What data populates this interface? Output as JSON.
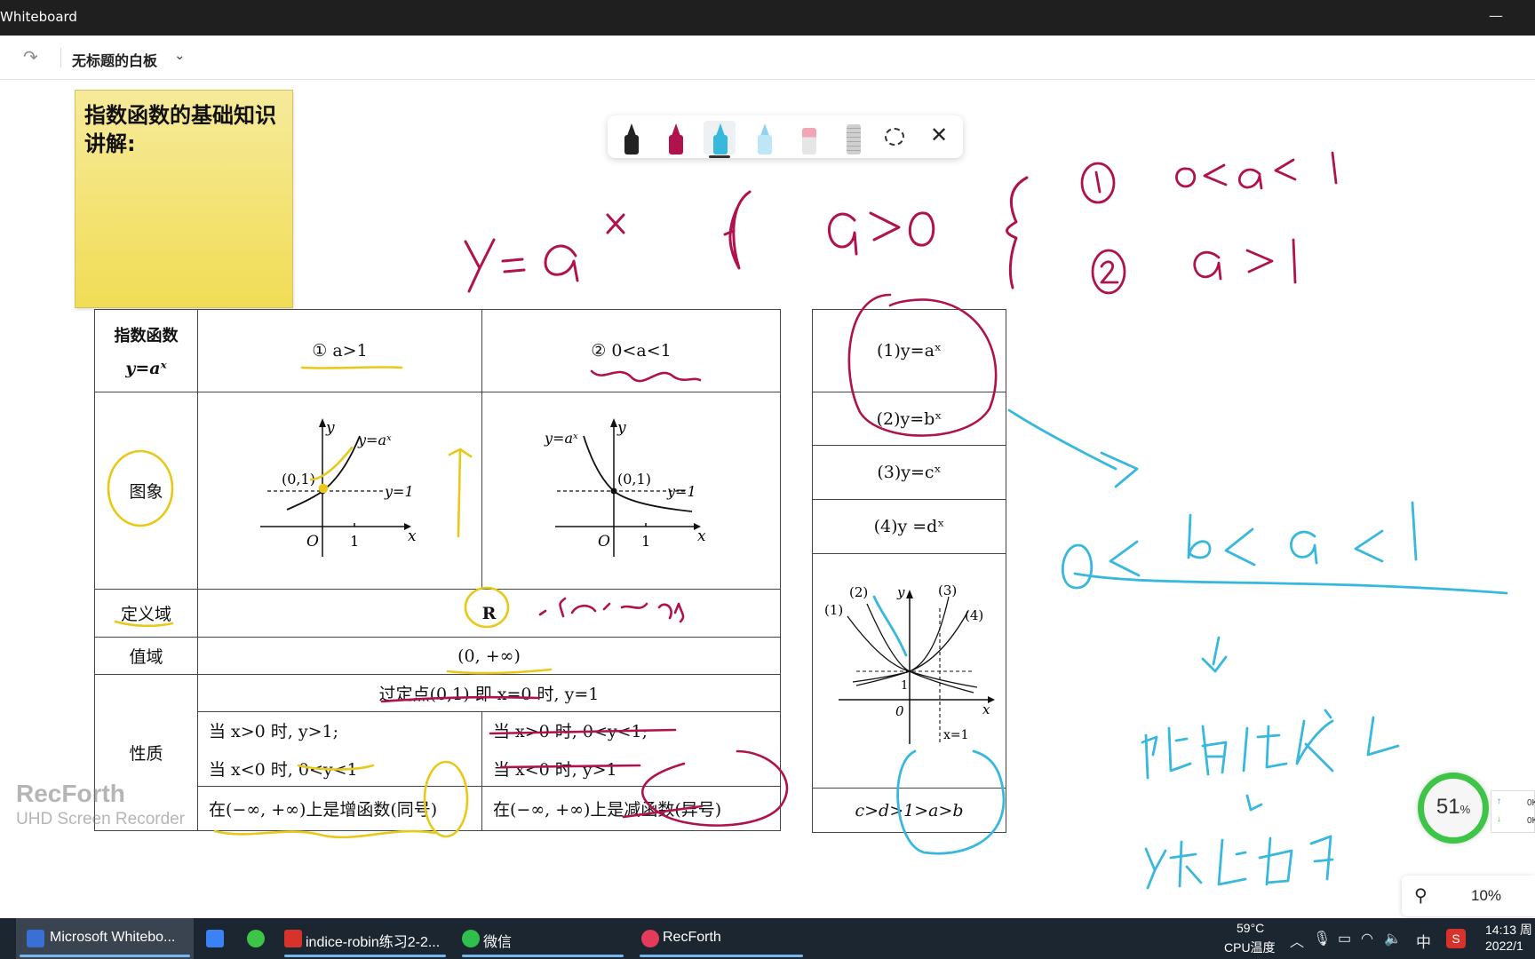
{
  "window": {
    "app_title": "Whiteboard"
  },
  "header": {
    "board_title": "无标题的白板"
  },
  "sticky_note": {
    "text": "指数函数的基础知识讲解:"
  },
  "pen_toolbar": {
    "tools": [
      {
        "name": "black-pen",
        "color": "#222222"
      },
      {
        "name": "magenta-pen",
        "color": "#b0124e"
      },
      {
        "name": "cyan-pen",
        "color": "#37b8dc"
      },
      {
        "name": "highlighter",
        "color": "#8fd4f2"
      },
      {
        "name": "eraser",
        "color": "#f2a5b5"
      },
      {
        "name": "ruler",
        "color": "#cfcfcf"
      }
    ],
    "selected_index": 2
  },
  "table": {
    "header_left_1": "指数函数",
    "header_left_2": "y=aˣ",
    "case1": "① a>1",
    "case2": "② 0<a<1",
    "row_graph": "图象",
    "row_domain": "定义域",
    "domain_value": "R",
    "row_range": "值域",
    "range_value": "(0, +∞)",
    "row_props": "性质",
    "fixed_point": "过定点(0,1)  即 x=0 时, y=1",
    "case1_p1": "当 x>0 时, y>1;",
    "case1_p2": "当 x<0 时, 0<y<1",
    "case2_p1": "当 x>0 时, 0<y<1;",
    "case2_p2": "当 x<0 时, y>1",
    "case1_mono": "在(−∞, +∞)上是增函数(同号)",
    "case2_mono": "在(−∞, +∞)上是减函数(异号)",
    "graph1": {
      "y_label": "y",
      "x_label": "x",
      "origin": "O",
      "one": "1",
      "point": "(0,1)",
      "curve": "y=aˣ",
      "asym": "y=1"
    },
    "graph2": {
      "y_label": "y",
      "x_label": "x",
      "origin": "O",
      "one": "1",
      "point": "(0,1)",
      "curve": "y=aˣ",
      "asym": "y=1"
    }
  },
  "side_table": {
    "rows": [
      "(1)y=aˣ",
      "(2)y=bˣ",
      "(3)y=cˣ",
      "(4)y =dˣ"
    ],
    "graph": {
      "l1": "(1)",
      "l2": "(2)",
      "l3": "(3)",
      "l4": "(4)",
      "y": "y",
      "x": "x",
      "zero": "0",
      "one": "1",
      "xeq1": "x=1"
    },
    "result": "c>d>1>a>b"
  },
  "watermark": {
    "title": "RecForth",
    "subtitle": "UHD Screen Recorder"
  },
  "zoom": {
    "level": "10%"
  },
  "cpu_widget": {
    "value": "51",
    "unit": "%",
    "net_up": "0K",
    "net_down": "0K"
  },
  "taskbar": {
    "items": [
      {
        "label": "Microsoft Whitebo...",
        "active": true
      },
      {
        "label": "indice-robin练习2-2..."
      },
      {
        "label": "微信"
      },
      {
        "label": "RecForth"
      }
    ],
    "weather_temp": "59°C",
    "weather_label": "CPU温度",
    "ime": "中",
    "time": "14:13 周",
    "date": "2022/1"
  }
}
